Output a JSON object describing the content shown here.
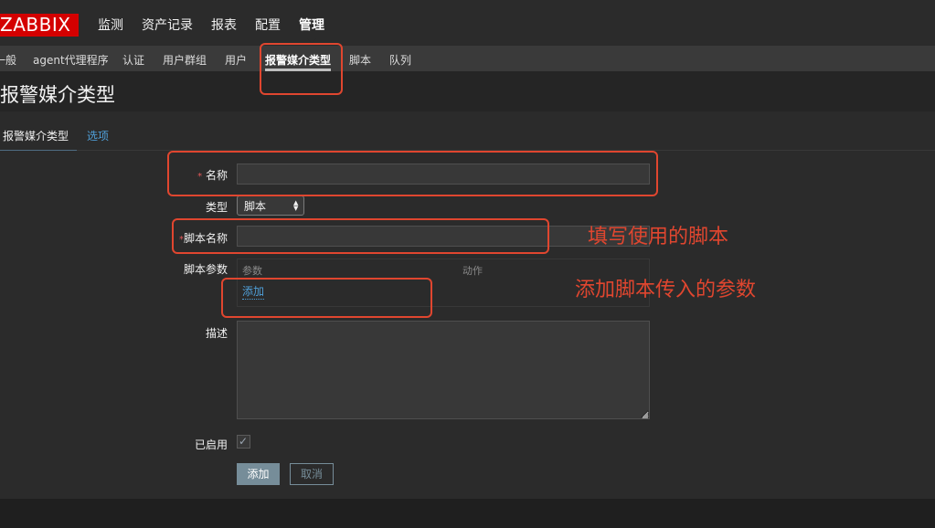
{
  "brand": {
    "logo_text": "ZABBIX"
  },
  "top_menu": {
    "items": [
      {
        "label": "监测"
      },
      {
        "label": "资产记录"
      },
      {
        "label": "报表"
      },
      {
        "label": "配置"
      },
      {
        "label": "管理",
        "active": true
      }
    ]
  },
  "sub_menu": {
    "items": [
      {
        "label": "一般"
      },
      {
        "label": "agent代理程序"
      },
      {
        "label": "认证"
      },
      {
        "label": "用户群组"
      },
      {
        "label": "用户"
      },
      {
        "label": "报警媒介类型",
        "active": true
      },
      {
        "label": "脚本"
      },
      {
        "label": "队列"
      }
    ]
  },
  "page": {
    "title": "报警媒介类型"
  },
  "tabs": [
    {
      "label": "报警媒介类型",
      "active": true
    },
    {
      "label": "选项"
    }
  ],
  "form": {
    "name_label": "名称",
    "name_value": "",
    "type_label": "类型",
    "type_value": "脚本",
    "script_name_label": "脚本名称",
    "script_name_value": "",
    "script_params_label": "脚本参数",
    "params_header_param": "参数",
    "params_header_action": "动作",
    "params_add_link": "添加",
    "description_label": "描述",
    "description_value": "",
    "enabled_label": "已启用",
    "enabled_checked": true,
    "required_marker": "*",
    "add_button": "添加",
    "cancel_button": "取消"
  },
  "annotations": {
    "script_note": "填写使用的脚本",
    "params_note": "添加脚本传入的参数"
  },
  "colors": {
    "accent_red": "#d40000",
    "annotation_red": "#e0462f",
    "link_blue": "#4f9fd8",
    "button_gray_blue": "#768d99"
  }
}
